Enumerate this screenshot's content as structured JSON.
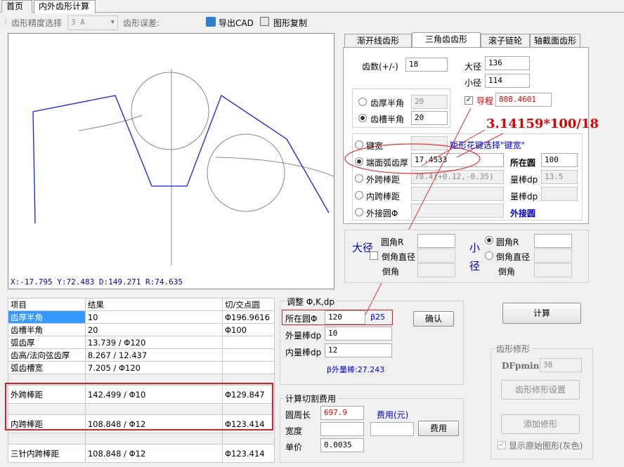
{
  "tabs": [
    "首页",
    "内外齿形计算"
  ],
  "toolbar": {
    "precision_label": "齿形精度选择",
    "precision_value": "3  A",
    "error_label": "齿形误差:",
    "export_cad": "导出CAD",
    "copy_figure": "图形复制"
  },
  "canvas": {
    "status": "X:-17.795  Y:72.483  D:149.271  R:74.635"
  },
  "right_tabs": [
    "渐开线齿形",
    "三角齿齿形",
    "滚子链轮",
    "轴截面齿形"
  ],
  "params": {
    "teeth_label": "齿数(+/-)",
    "teeth_value": "18",
    "major_label": "大径",
    "major_value": "136",
    "minor_label": "小径",
    "minor_value": "114",
    "tooth_half_label": "齿厚半角",
    "tooth_half_value": "20",
    "groove_half_label": "齿槽半角",
    "groove_half_value": "20",
    "lead_label": "导程",
    "lead_value": "808.4601",
    "key_width_label": "键宽",
    "arc_thick_label": "端面弧齿厚",
    "arc_thick_value": "17.4533",
    "at_circle_label": "所在圆",
    "at_circle_value": "100",
    "outer_span_label": "外跨棒距",
    "outer_span_value": "78.4(+0.12,-0.35)",
    "pin_dia_label": "量棒dp",
    "pin_dia_value": "13.5",
    "inner_span_label": "内跨棒距",
    "pin_dia2_label": "量棒dp",
    "circumcircle_label": "外接圆Φ",
    "circumcircle_link": "外接圆"
  },
  "annotations": {
    "formula": "3.14159*100/18",
    "hint": "矩形花键选择\"键宽\""
  },
  "fillet": {
    "big_label": "大径",
    "small_label": "小径",
    "radius_label": "圆角R",
    "chamfer_dia_label": "倒角直径",
    "chamfer_label": "倒角"
  },
  "results": {
    "headers": [
      "项目",
      "结果",
      "切/交点圆"
    ],
    "rows": [
      [
        "齿厚半角",
        "10",
        "Φ196.9616"
      ],
      [
        "齿槽半角",
        "20",
        "Φ100"
      ],
      [
        "弧齿厚",
        "13.739 / Φ120",
        ""
      ],
      [
        "齿高/法向弦齿厚",
        "8.267 / 12.437",
        ""
      ],
      [
        "弧齿槽宽",
        "7.205 / Φ120",
        ""
      ],
      [
        "",
        "",
        ""
      ],
      [
        "外跨棒距",
        "142.499 / Φ10",
        "Φ129.847"
      ],
      [
        "",
        "",
        ""
      ],
      [
        "内跨棒距",
        "108.848 / Φ12",
        "Φ123.414"
      ],
      [
        "",
        "",
        ""
      ],
      [
        "三针内跨棒距",
        "108.848 / Φ12",
        "Φ123.414"
      ]
    ]
  },
  "adjust": {
    "title": "调整 Φ,K,dp",
    "circle_label": "所在圆Φ",
    "circle_value": "120",
    "beta_value": "β25",
    "confirm": "确认",
    "outer_pin_label": "外量棒dp",
    "outer_pin_value": "10",
    "inner_pin_label": "内量棒dp",
    "inner_pin_value": "12",
    "beta_outer": "β外量棒:27.243"
  },
  "cost": {
    "title": "计算切割费用",
    "circumference_label": "圆周长",
    "circumference_value": "697.9",
    "cost_label": "费用(元)",
    "width_label": "宽度",
    "price_label": "单价",
    "price_value": "0.0035",
    "cost_button": "费用"
  },
  "calc_button": "计算",
  "modify": {
    "title": "齿形修形",
    "dfpmin_label": "DFpmin",
    "dfpmin_value": "38",
    "settings_button": "齿形修形设置",
    "add_button": "添加修形",
    "show_original": "显示原始图形(灰色)"
  },
  "colors": {
    "selection": "#3399ff",
    "highlight": "#d00000",
    "link": "#0000dd"
  }
}
